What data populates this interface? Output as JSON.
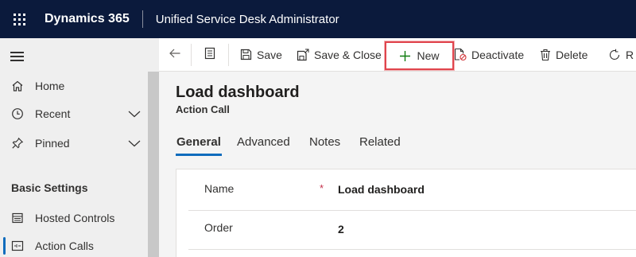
{
  "topbar": {
    "brand": "Dynamics 365",
    "app_title": "Unified Service Desk Administrator"
  },
  "sidebar": {
    "items": [
      {
        "label": "Home",
        "icon": "home-icon"
      },
      {
        "label": "Recent",
        "icon": "clock-icon"
      },
      {
        "label": "Pinned",
        "icon": "pin-icon"
      }
    ],
    "group_title": "Basic Settings",
    "group_items": [
      {
        "label": "Hosted Controls",
        "icon": "hosted-controls-icon"
      },
      {
        "label": "Action Calls",
        "icon": "action-calls-icon"
      }
    ]
  },
  "commandbar": {
    "save": "Save",
    "save_close": "Save & Close",
    "new": "New",
    "deactivate": "Deactivate",
    "delete": "Delete",
    "refresh": "R"
  },
  "record": {
    "title": "Load dashboard",
    "entity": "Action Call"
  },
  "tabs": [
    {
      "label": "General",
      "active": true
    },
    {
      "label": "Advanced",
      "active": false
    },
    {
      "label": "Notes",
      "active": false
    },
    {
      "label": "Related",
      "active": false
    }
  ],
  "form": {
    "fields": [
      {
        "label": "Name",
        "required_marker": "*",
        "value": "Load dashboard"
      },
      {
        "label": "Order",
        "value": "2"
      }
    ]
  },
  "colors": {
    "topbar": "#0b1a3c",
    "accent": "#0f6cbd",
    "highlight": "#e0454d"
  }
}
